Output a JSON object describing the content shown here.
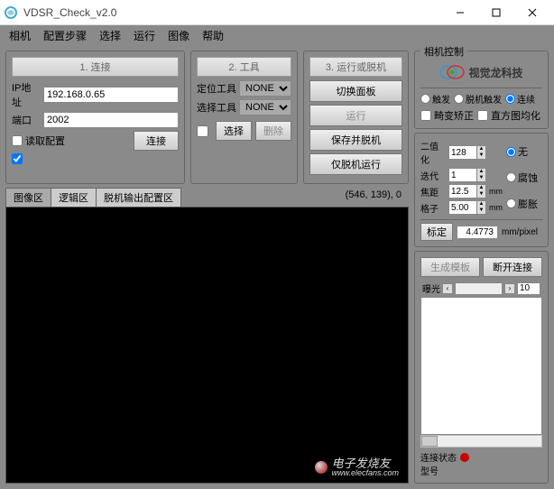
{
  "window": {
    "title": "VDSR_Check_v2.0"
  },
  "menu": {
    "items": [
      "相机",
      "配置步骤",
      "选择",
      "运行",
      "图像",
      "帮助"
    ]
  },
  "panel1": {
    "header": "1. 连接",
    "ip_label": "IP地址",
    "ip_value": "192.168.0.65",
    "port_label": "端口",
    "port_value": "2002",
    "read_cfg": "读取配置",
    "connect_btn": "连接"
  },
  "panel2": {
    "header": "2. 工具",
    "loc_label": "定位工具",
    "loc_value": "NONE",
    "sel_label": "选择工具",
    "sel_value": "NONE",
    "choose_btn": "选择",
    "delete_btn": "删除"
  },
  "panel3": {
    "header": "3. 运行或脱机",
    "btn1": "切换面板",
    "btn2": "运行",
    "btn3": "保存并脱机",
    "btn4": "仅脱机运行"
  },
  "tabs": {
    "img": "图像区",
    "logic": "逻辑区",
    "offline": "脱机输出配置区"
  },
  "coords": "(546, 139), 0",
  "camctrl": {
    "title": "相机控制",
    "brand": "视觉龙科技",
    "modes": {
      "trigger": "触发",
      "offline_trigger": "脱机触发",
      "continuous": "连续",
      "distortion": "畸变矫正",
      "histogram": "直方图均化"
    },
    "bin_label": "二值化",
    "bin_value": "128",
    "iter_label": "迭代",
    "iter_value": "1",
    "focal_label": "焦距",
    "focal_value": "12.5",
    "grid_label": "格子",
    "grid_value": "5.00",
    "morph": {
      "none": "无",
      "erode": "腐蚀",
      "dilate": "膨胀"
    },
    "calib_btn": "标定",
    "calib_value": "4.4773",
    "calib_unit": "mm/pixel",
    "gen_template": "生成模板",
    "disconnect": "断开连接",
    "exposure_label": "曝光",
    "exposure_value": "10",
    "conn_status_label": "连接状态",
    "model_label": "型号",
    "unit_mm": "mm"
  },
  "watermark": "电子发烧友\nwww.elecfans.com"
}
